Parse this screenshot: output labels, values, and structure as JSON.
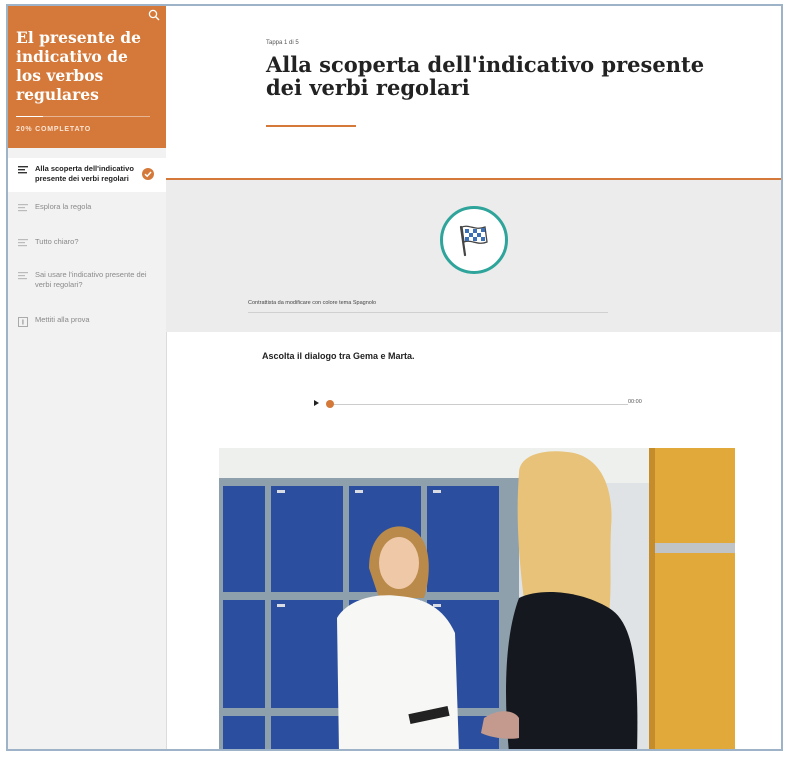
{
  "sidebar": {
    "course_title": "El presente de indicativo de los verbos regulares",
    "progress_label": "20% COMPLETATO",
    "progress_value": 0.2,
    "search_icon": "search-icon",
    "items": [
      {
        "label": "Alla scoperta dell'indicativo presente dei verbi regolari",
        "icon": "text-lines-icon",
        "active": true,
        "completed": true
      },
      {
        "label": "Esplora la regola",
        "icon": "text-lines-icon"
      },
      {
        "label": "Tutto chiaro?",
        "icon": "text-lines-icon"
      },
      {
        "label": "Sai usare l'indicativo presente dei verbi regolari?",
        "icon": "text-lines-icon"
      },
      {
        "label": "Mettiti alla prova",
        "icon": "quiz-icon"
      }
    ]
  },
  "header": {
    "menu_icon": "hamburger-icon",
    "step_label": "Tappa 1 di 5",
    "title": "Alla scoperta dell'indicativo presente dei verbi regolari"
  },
  "banner": {
    "icon": "checkered-flag-icon",
    "caption": "Contrattista da modificare con colore tema Spagnolo"
  },
  "lesson": {
    "instruction": "Ascolta il dialogo tra Gema e Marta.",
    "audio": {
      "time": "00:00",
      "progress": 0.0
    }
  },
  "colors": {
    "accent": "#d4793a",
    "teal": "#2ea49a",
    "locker_blue": "#2b4f9e",
    "sidebar_bg": "#f2f2f2"
  }
}
